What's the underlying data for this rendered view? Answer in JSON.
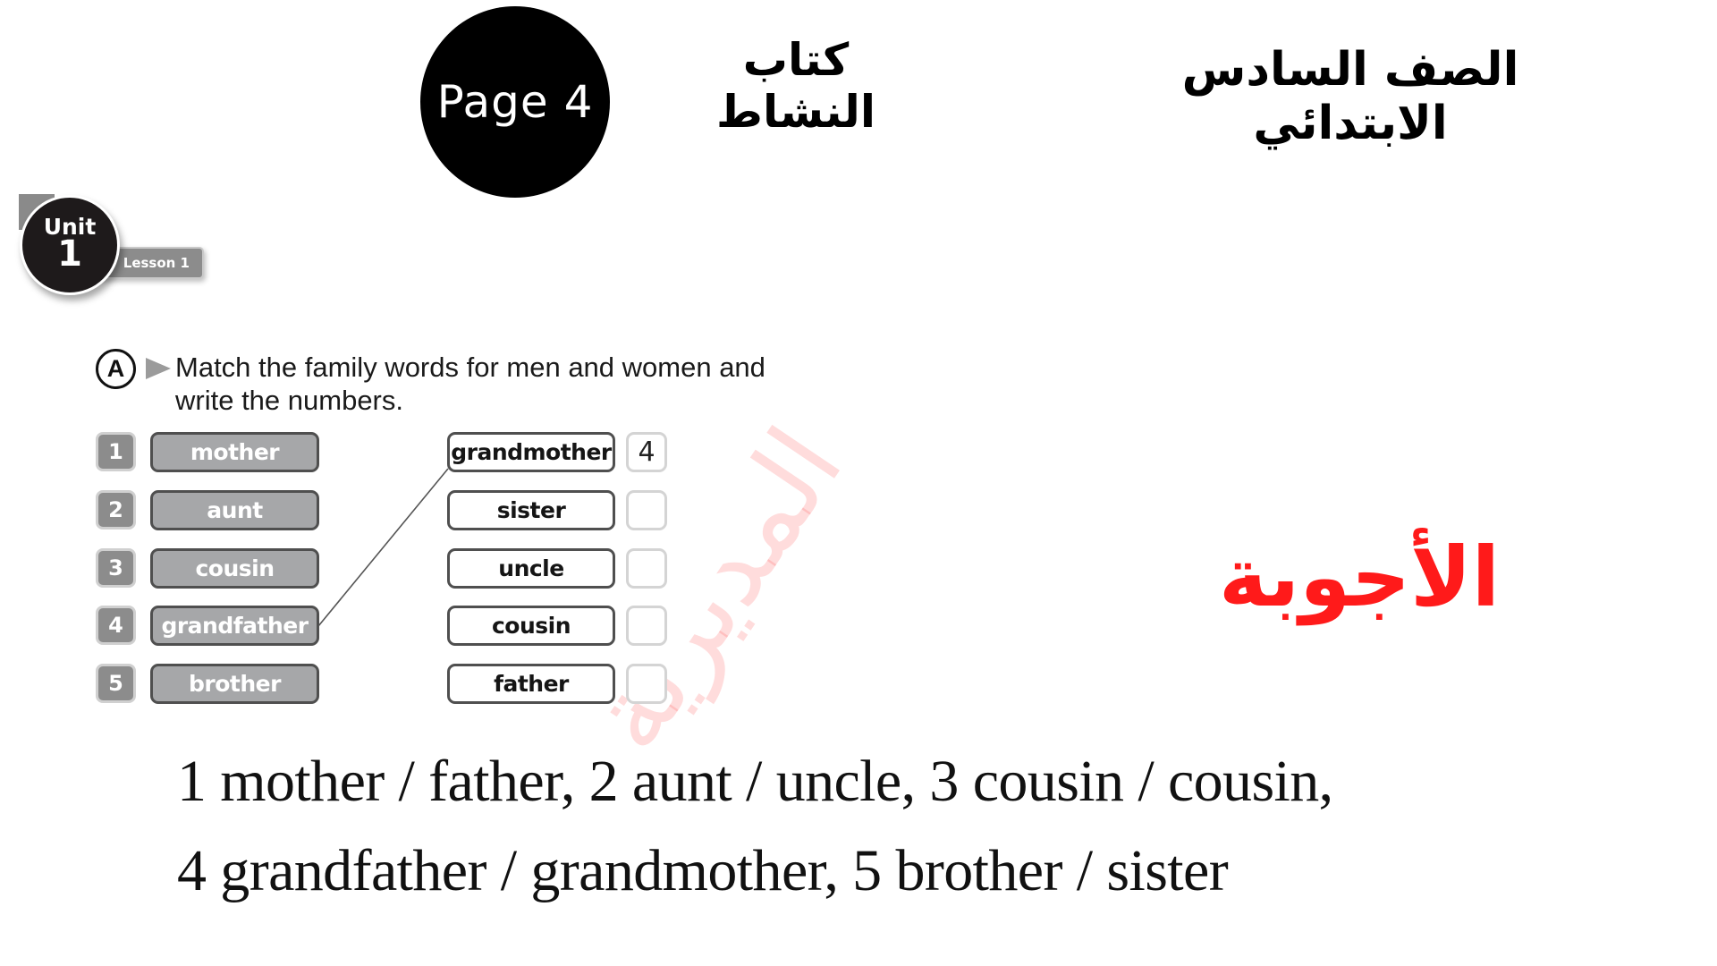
{
  "header": {
    "page_label": "Page 4",
    "book_title": "كتاب النشاط",
    "grade_title": "الصف السادس الابتدائي"
  },
  "unit_badge": {
    "unit_word": "Unit",
    "unit_number": "1",
    "lesson": "Lesson 1"
  },
  "exercise": {
    "letter": "A",
    "instruction_line1": "Match the family words for men and women and",
    "instruction_line2": "write the numbers.",
    "left_items": [
      {
        "number": "1",
        "word": "mother"
      },
      {
        "number": "2",
        "word": "aunt"
      },
      {
        "number": "3",
        "word": "cousin"
      },
      {
        "number": "4",
        "word": "grandfather"
      },
      {
        "number": "5",
        "word": "brother"
      }
    ],
    "right_items": [
      {
        "word": "grandmother",
        "answer": "4"
      },
      {
        "word": "sister",
        "answer": ""
      },
      {
        "word": "uncle",
        "answer": ""
      },
      {
        "word": "cousin",
        "answer": ""
      },
      {
        "word": "father",
        "answer": ""
      }
    ],
    "example_match": {
      "left_number": "4",
      "right_word": "grandmother"
    }
  },
  "watermark": "المديرية",
  "answers": {
    "heading": "الأجوبة",
    "heading_color": "#ff1a1a",
    "line1": "1 mother / father, 2 aunt / uncle, 3 cousin / cousin,",
    "line2": "4 grandfather / grandmother, 5 brother / sister"
  }
}
